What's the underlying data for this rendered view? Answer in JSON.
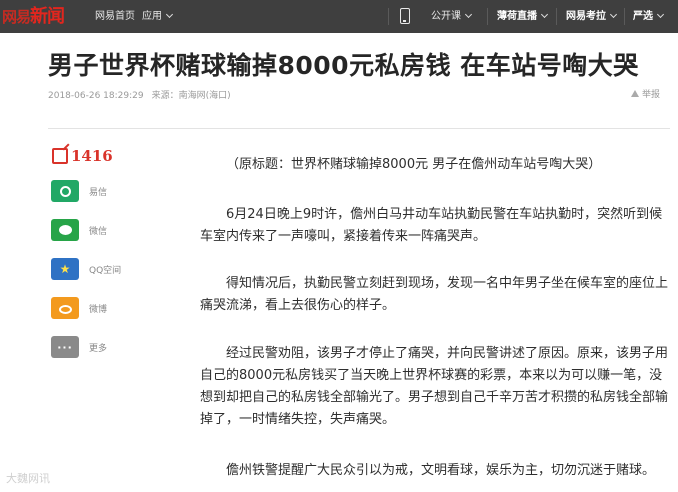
{
  "topbar": {
    "logo_part1": "网易",
    "logo_part2": "新闻",
    "home": "网易首页",
    "apps": "应用",
    "open_course": "公开课",
    "mint_live": "薄荷直播",
    "exam": "网易考拉",
    "yanxuan": "严选"
  },
  "article": {
    "title": "男子世界杯赌球输掉8000元私房钱 在车站号啕大哭",
    "datetime": "2018-06-26 18:29:29",
    "source": "来源：南海网(海口)",
    "report": "举报",
    "paragraphs": [
      "（原标题：世界杯赌球输掉8000元 男子在儋州动车站号啕大哭）",
      "6月24日晚上9时许，儋州白马井动车站执勤民警在车站执勤时，突然听到候车室内传来了一声嚎叫，紧接着传来一阵痛哭声。",
      "得知情况后，执勤民警立刻赶到现场，发现一名中年男子坐在候车室的座位上痛哭流涕，看上去很伤心的样子。",
      "经过民警劝阻，该男子才停止了痛哭，并向民警讲述了原因。原来，该男子用自己的8000元私房钱买了当天晚上世界杯球赛的彩票，本来以为可以赚一笔，没想到却把自己的私房钱全部输光了。男子想到自己千辛万苦才积攒的私房钱全部输掉了，一时情绪失控，失声痛哭。",
      "儋州铁警提醒广大民众引以为戒，文明看球，娱乐为主，切勿沉迷于赌球。"
    ]
  },
  "share": {
    "comment_count": "1416",
    "items": [
      {
        "label": "易信",
        "icon": "yixin-icon"
      },
      {
        "label": "微信",
        "icon": "wechat-icon"
      },
      {
        "label": "QQ空间",
        "icon": "qzone-icon"
      },
      {
        "label": "微博",
        "icon": "weibo-icon"
      },
      {
        "label": "更多",
        "icon": "more-icon"
      }
    ]
  },
  "watermark": "大魏网讯",
  "colors": {
    "topbar": "#3f3f3f",
    "brand_red": "#e2261e",
    "yixin": "#21a866",
    "wechat": "#27a448",
    "qzone": "#2f72c4",
    "weibo": "#f39a1e",
    "more": "#8a8a8a"
  }
}
